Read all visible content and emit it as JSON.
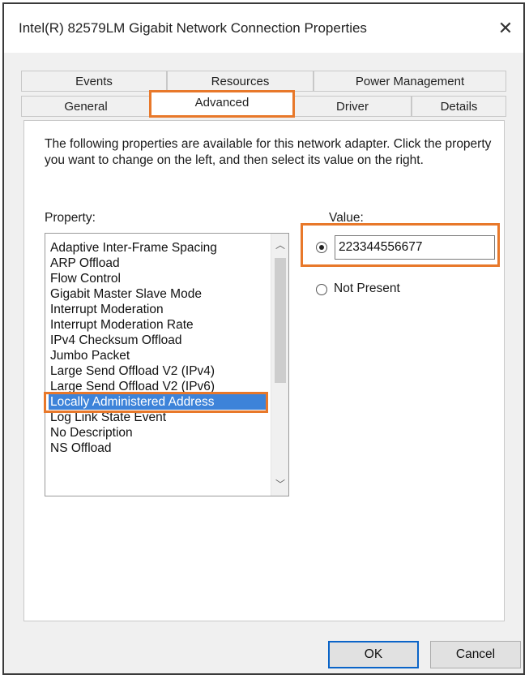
{
  "window": {
    "title": "Intel(R) 82579LM Gigabit Network Connection Properties",
    "close_glyph": "✕"
  },
  "tabs": {
    "row1": [
      {
        "label": "Events"
      },
      {
        "label": "Resources"
      },
      {
        "label": "Power Management"
      }
    ],
    "row2": [
      {
        "label": "General"
      },
      {
        "label": "Advanced",
        "active": true
      },
      {
        "label": "Driver"
      },
      {
        "label": "Details"
      }
    ]
  },
  "advanced": {
    "description": "The following properties are available for this network adapter. Click the property you want to change on the left, and then select its value on the right.",
    "property_label": "Property:",
    "value_label": "Value:",
    "properties": [
      "Adaptive Inter-Frame Spacing",
      "ARP Offload",
      "Flow Control",
      "Gigabit Master Slave Mode",
      "Interrupt Moderation",
      "Interrupt Moderation Rate",
      "IPv4 Checksum Offload",
      "Jumbo Packet",
      "Large Send Offload V2 (IPv4)",
      "Large Send Offload V2 (IPv6)",
      "Locally Administered Address",
      "Log Link State Event",
      "No Description",
      "NS Offload"
    ],
    "selected_property": "Locally Administered Address",
    "value_input": "223344556677",
    "not_present_label": "Not Present",
    "value_radio_selected": "value"
  },
  "buttons": {
    "ok": "OK",
    "cancel": "Cancel"
  },
  "colors": {
    "highlight": "#e8782a",
    "selection": "#3d83d9",
    "default_button_border": "#0a64c8"
  },
  "icons": {
    "close": "close-icon",
    "scroll_up": "chevron-up-icon",
    "scroll_down": "chevron-down-icon"
  }
}
